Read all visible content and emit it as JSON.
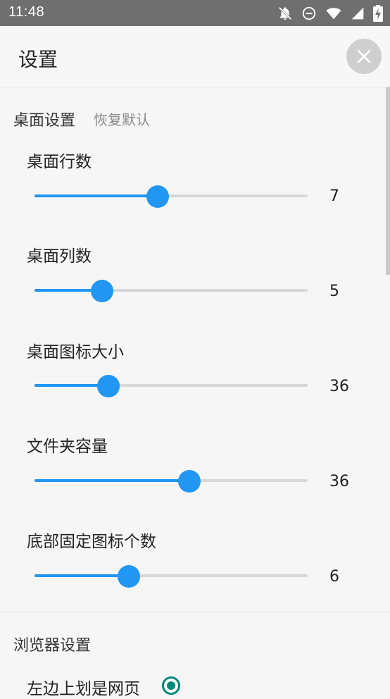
{
  "status_bar": {
    "time": "11:48",
    "icons": [
      "notifications-off-icon",
      "do-not-disturb-icon",
      "wifi-icon",
      "cellular-signal-icon",
      "battery-charging-icon"
    ]
  },
  "app_bar": {
    "title": "设置",
    "close_icon": "close-icon"
  },
  "desktop_section": {
    "title": "桌面设置",
    "reset_label": "恢复默认",
    "settings": [
      {
        "label": "桌面行数",
        "value": "7",
        "fraction": 0.45
      },
      {
        "label": "桌面列数",
        "value": "5",
        "fraction": 0.247
      },
      {
        "label": "桌面图标大小",
        "value": "36",
        "fraction": 0.27
      },
      {
        "label": "文件夹容量",
        "value": "36",
        "fraction": 0.567
      },
      {
        "label": "底部固定图标个数",
        "value": "6",
        "fraction": 0.345
      }
    ]
  },
  "browser_section": {
    "title": "浏览器设置",
    "option_label": "左边上划是网页",
    "option_selected": true
  },
  "colors": {
    "accent": "#2196f3",
    "radio": "#00897b",
    "status_bar": "#6f6f6f"
  }
}
